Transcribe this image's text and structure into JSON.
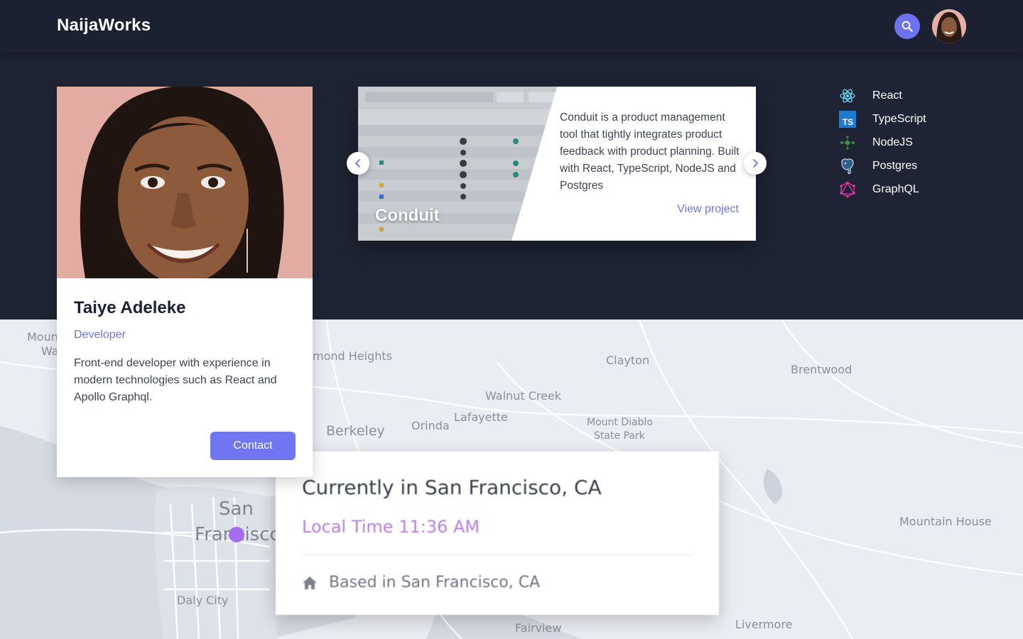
{
  "header": {
    "brand": "NaijaWorks",
    "search_icon": "search-icon",
    "avatar_icon": "user-avatar"
  },
  "profile": {
    "name": "Taiye Adeleke",
    "role": "Developer",
    "bio": "Front-end developer with experience in modern technologies such as React and Apollo Graphql.",
    "contact_label": "Contact"
  },
  "project": {
    "title": "Conduit",
    "description": "Conduit is a product management tool that tightly integrates product feedback with product planning. Built with React, TypeScript, NodeJS and Postgres",
    "link_label": "View project",
    "prev_icon": "chevron-left-icon",
    "next_icon": "chevron-right-icon"
  },
  "tech": [
    {
      "label": "React",
      "icon": "react-icon"
    },
    {
      "label": "TypeScript",
      "icon": "typescript-icon"
    },
    {
      "label": "NodeJS",
      "icon": "nodejs-icon"
    },
    {
      "label": "Postgres",
      "icon": "postgres-icon"
    },
    {
      "label": "GraphQL",
      "icon": "graphql-icon"
    }
  ],
  "location": {
    "title": "Currently in San Francisco, CA",
    "time_prefix": "Local Time",
    "time_value": "11:36 AM",
    "based": "Based in San Francisco, CA",
    "home_icon": "home-icon"
  },
  "map_labels": [
    "Mount",
    "Wa",
    "mond Heights",
    "Clayton",
    "Brentwood",
    "Walnut Creek",
    "Lafayette",
    "Berkeley",
    "Orinda",
    "Mount Diablo",
    "State Park",
    "San",
    "Francisco",
    "Mountain House",
    "Daly City",
    "Fairview",
    "Livermore"
  ],
  "colors": {
    "accent": "#6d72f0",
    "header_bg": "#1b2130",
    "hero_bg": "#1e2433",
    "time_color": "#b77de6"
  }
}
